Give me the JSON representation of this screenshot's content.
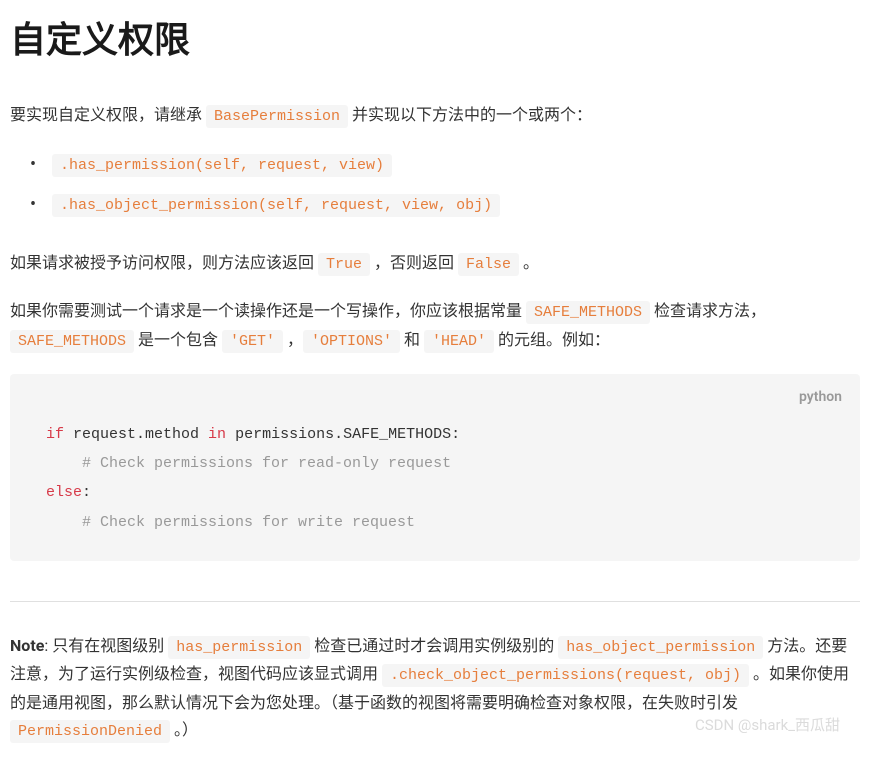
{
  "title": "自定义权限",
  "para1": {
    "t1": "要实现自定义权限，请继承 ",
    "c1": "BasePermission",
    "t2": " 并实现以下方法中的一个或两个："
  },
  "methods": {
    "m1": ".has_permission(self, request, view)",
    "m2": ".has_object_permission(self, request, view, obj)"
  },
  "para2": {
    "t1": "如果请求被授予访问权限，则方法应该返回 ",
    "c1": "True",
    "t2": " ，否则返回 ",
    "c2": "False",
    "t3": " 。"
  },
  "para3": {
    "t1": "如果你需要测试一个请求是一个读操作还是一个写操作，你应该根据常量 ",
    "c1": "SAFE_METHODS",
    "t2": " 检查请求方法，",
    "c2": "SAFE_METHODS",
    "t3": " 是一个包含 ",
    "c3": "'GET'",
    "t4": " ，",
    "c4": "'OPTIONS'",
    "t5": " 和 ",
    "c5": "'HEAD'",
    "t6": " 的元组。例如："
  },
  "codeblock": {
    "lang": "python",
    "kw_if": "if",
    "l1_a": " request.method ",
    "kw_in": "in",
    "l1_b": " permissions.SAFE_METHODS:",
    "l2": "    # Check permissions for read-only request",
    "kw_else": "else",
    "l3_colon": ":",
    "l4": "    # Check permissions for write request"
  },
  "note": {
    "label": "Note",
    "t1": ": 只有在视图级别 ",
    "c1": "has_permission",
    "t2": " 检查已通过时才会调用实例级别的 ",
    "c2": "has_object_permission",
    "t3": " 方法。还要注意，为了运行实例级检查，视图代码应该显式调用 ",
    "c3": ".check_object_permissions(request, obj)",
    "t4": " 。如果你使用的是通用视图，那么默认情况下会为您处理。（基于函数的视图将需要明确检查对象权限，在失败时引发 ",
    "c4": "PermissionDenied",
    "t5": " 。）"
  },
  "watermark": "CSDN @shark_西瓜甜"
}
